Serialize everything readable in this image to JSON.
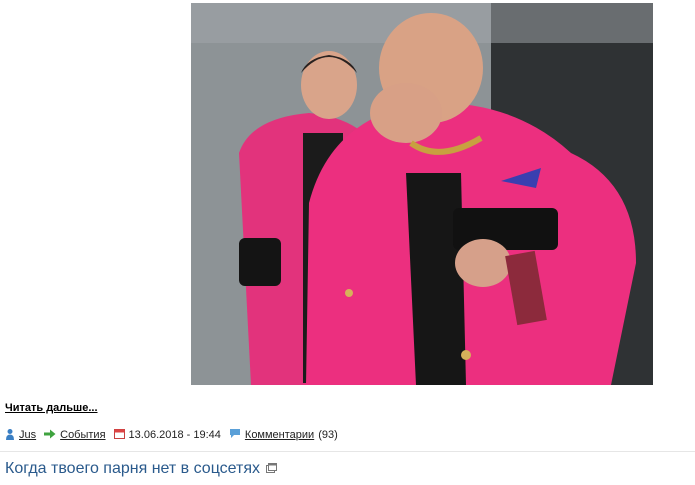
{
  "post": {
    "read_more_label": "Читать дальше...",
    "author": "Jus",
    "category": "События",
    "date": "13.06.2018 - 19:44",
    "comments_label": "Комментарии",
    "comments_count": "(93)"
  },
  "next_article": {
    "title": "Когда твоего парня нет в соцсетях"
  },
  "icons": {
    "author": "user-icon",
    "category": "green-arrow-icon",
    "date": "calendar-icon",
    "comments": "comment-bubble-icon",
    "title": "external-window-icon"
  },
  "colors": {
    "title_link": "#2a5a8c",
    "jacket": "#e8307a"
  }
}
